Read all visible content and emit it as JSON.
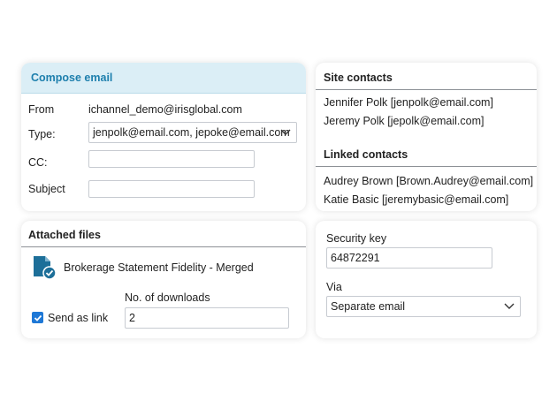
{
  "compose": {
    "title": "Compose email",
    "from_label": "From",
    "from_value": "ichannel_demo@irisglobal.com",
    "type_label": "Type:",
    "type_value": "jenpolk@email.com, jepoke@email.com",
    "cc_label": "CC:",
    "cc_value": "",
    "subject_label": "Subject",
    "subject_value": ""
  },
  "attached": {
    "title": "Attached files",
    "file_name": "Brokerage Statement Fidelity - Merged",
    "downloads_label": "No. of downloads",
    "downloads_value": "2",
    "send_link_label": "Send as link",
    "send_link_checked": true
  },
  "contacts": {
    "site_title": "Site contacts",
    "site": [
      "Jennifer Polk [jenpolk@email.com]",
      "Jeremy Polk [jepolk@email.com]"
    ],
    "linked_title": "Linked contacts",
    "linked": [
      "Audrey Brown [Brown.Audrey@email.com]",
      "Katie Basic [jeremybasic@email.com]"
    ]
  },
  "security": {
    "key_label": "Security key",
    "key_value": "64872291",
    "via_label": "Via",
    "via_value": "Separate email"
  },
  "colors": {
    "accent": "#1d7fad",
    "header_bg": "#dbeef6",
    "checkbox": "#1e78d6",
    "file_icon": "#1d6f99"
  },
  "icons": {
    "chevron": "chevron-down-icon",
    "file": "document-check-icon",
    "check": "check-icon"
  }
}
